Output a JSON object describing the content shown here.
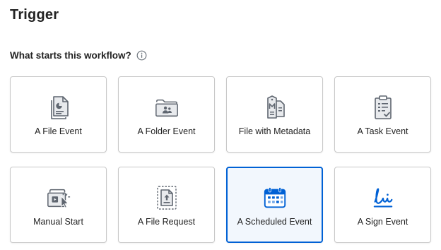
{
  "page": {
    "title": "Trigger",
    "question": "What starts this workflow?"
  },
  "colors": {
    "accent": "#0061d5",
    "icon_gray": "#5f6670",
    "border": "#c8c8c8"
  },
  "triggers": [
    {
      "label": "A File Event",
      "icon": "file-event-icon",
      "selected": false
    },
    {
      "label": "A Folder Event",
      "icon": "folder-event-icon",
      "selected": false
    },
    {
      "label": "File with Metadata",
      "icon": "metadata-icon",
      "selected": false
    },
    {
      "label": "A Task Event",
      "icon": "task-event-icon",
      "selected": false
    },
    {
      "label": "Manual Start",
      "icon": "manual-start-icon",
      "selected": false
    },
    {
      "label": "A File Request",
      "icon": "file-request-icon",
      "selected": false
    },
    {
      "label": "A Scheduled Event",
      "icon": "calendar-icon",
      "selected": true
    },
    {
      "label": "A Sign Event",
      "icon": "sign-icon",
      "selected": false
    }
  ]
}
